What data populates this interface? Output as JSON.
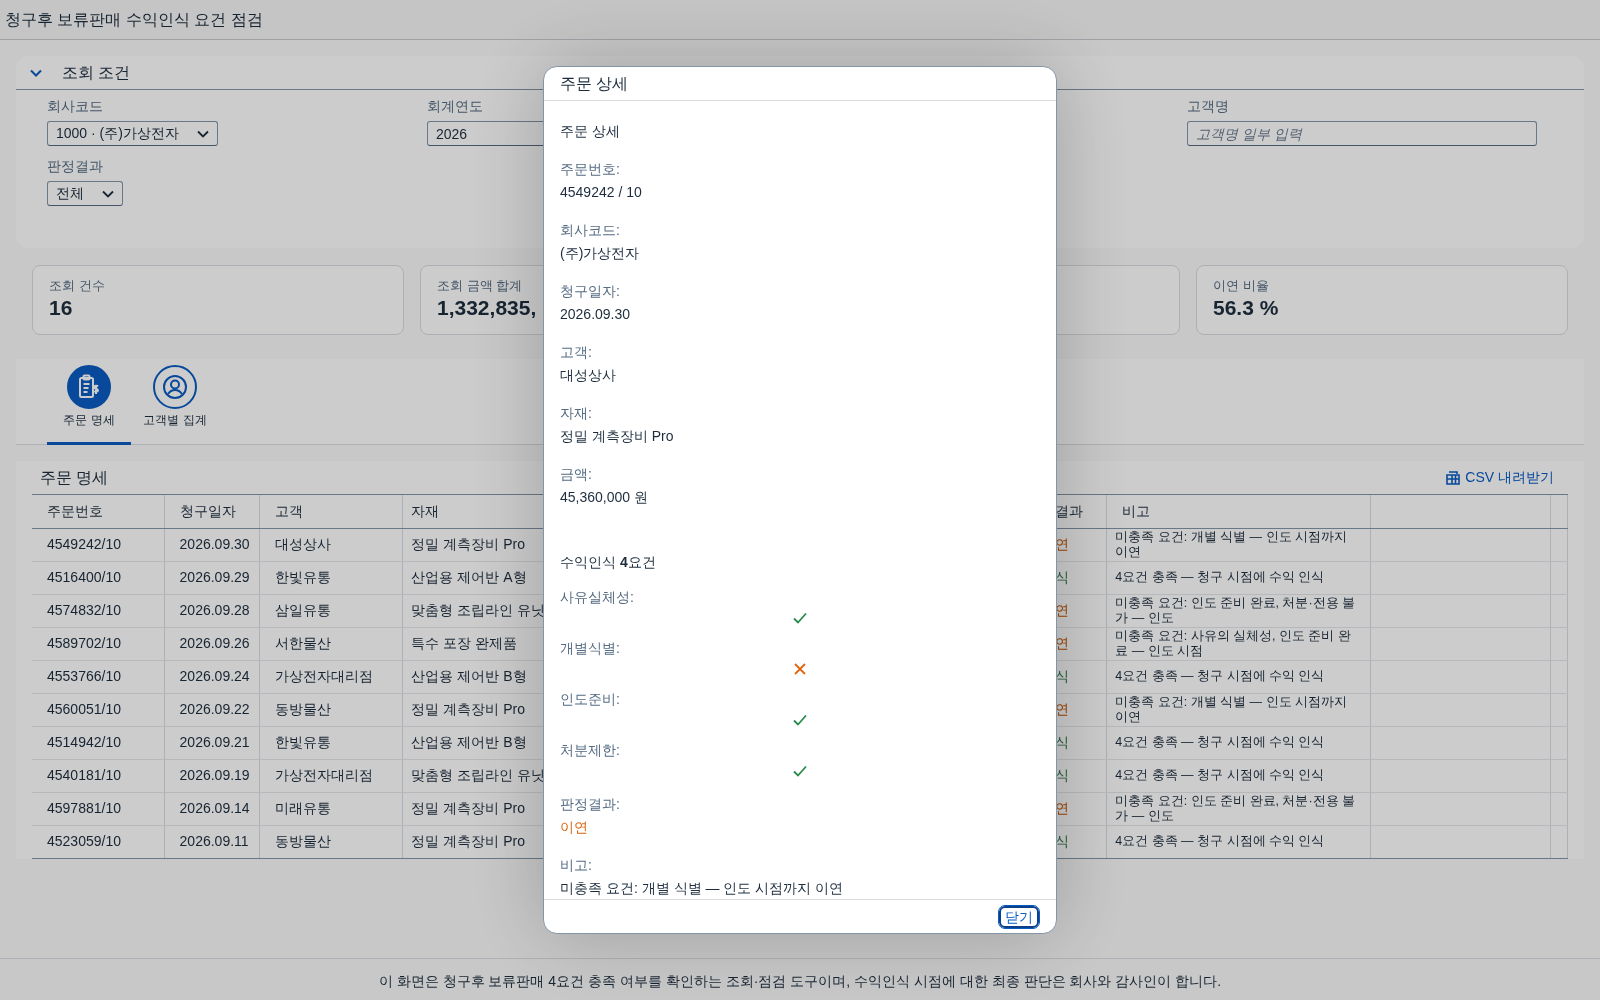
{
  "app_title": "청구후 보류판매 수익인식 요건 점검",
  "filter_panel": {
    "title": "조회 조건",
    "expanded": true,
    "fields": [
      {
        "kind": "select",
        "label": "회사코드",
        "value": "1000 · (주)가상전자"
      },
      {
        "kind": "input",
        "label": "회계연도",
        "value": "2026"
      },
      {
        "kind": "input",
        "label": "고객명",
        "placeholder": "고객명 일부 입력"
      },
      {
        "kind": "select",
        "label": "판정결과",
        "value": "전체"
      }
    ]
  },
  "kpis": [
    {
      "label": "조회 건수",
      "value": "16"
    },
    {
      "label": "조회 금액 합계",
      "value": "1,332,835,"
    },
    {
      "label": "이연 비율",
      "value": "56.3 %"
    }
  ],
  "tabs": [
    {
      "label": "주문 명세",
      "selected": true
    },
    {
      "label": "고객별 집계",
      "selected": false
    }
  ],
  "table": {
    "title": "주문 명세",
    "csv_button": "CSV 내려받기",
    "columns": [
      "주문번호",
      "청구일자",
      "고객",
      "자재",
      "결과",
      "비고"
    ],
    "rows": [
      {
        "cells": [
          "4549242/10",
          "2026.09.30",
          "대성상사",
          "정밀 계측장비 Pro"
        ],
        "result": {
          "text": "연",
          "kind": "deferred"
        },
        "note": "미충족 요건: 개별 식별 — 인도 시점까지 이연"
      },
      {
        "cells": [
          "4516400/10",
          "2026.09.29",
          "한빛유통",
          "산업용 제어반 A형"
        ],
        "result": {
          "text": "식",
          "kind": "recognized"
        },
        "note": "4요건 충족 — 청구 시점에 수익 인식"
      },
      {
        "cells": [
          "4574832/10",
          "2026.09.28",
          "삼일유통",
          "맞춤형 조립라인 유닛"
        ],
        "result": {
          "text": "연",
          "kind": "deferred"
        },
        "note": "미충족 요건: 인도 준비 완료, 처분·전용 불가 — 인도"
      },
      {
        "cells": [
          "4589702/10",
          "2026.09.26",
          "서한물산",
          "특수 포장 완제품"
        ],
        "result": {
          "text": "연",
          "kind": "deferred"
        },
        "note": "미충족 요건: 사유의 실체성, 인도 준비 완료 — 인도 시점"
      },
      {
        "cells": [
          "4553766/10",
          "2026.09.24",
          "가상전자대리점",
          "산업용 제어반 B형"
        ],
        "result": {
          "text": "식",
          "kind": "recognized"
        },
        "note": "4요건 충족 — 청구 시점에 수익 인식"
      },
      {
        "cells": [
          "4560051/10",
          "2026.09.22",
          "동방물산",
          "정밀 계측장비 Pro"
        ],
        "result": {
          "text": "연",
          "kind": "deferred"
        },
        "note": "미충족 요건: 개별 식별 — 인도 시점까지 이연"
      },
      {
        "cells": [
          "4514942/10",
          "2026.09.21",
          "한빛유통",
          "산업용 제어반 B형"
        ],
        "result": {
          "text": "식",
          "kind": "recognized"
        },
        "note": "4요건 충족 — 청구 시점에 수익 인식"
      },
      {
        "cells": [
          "4540181/10",
          "2026.09.19",
          "가상전자대리점",
          "맞춤형 조립라인 유닛"
        ],
        "result": {
          "text": "식",
          "kind": "recognized"
        },
        "note": "4요건 충족 — 청구 시점에 수익 인식"
      },
      {
        "cells": [
          "4597881/10",
          "2026.09.14",
          "미래유통",
          "정밀 계측장비 Pro"
        ],
        "result": {
          "text": "연",
          "kind": "deferred"
        },
        "note": "미충족 요건: 인도 준비 완료, 처분·전용 불가 — 인도"
      },
      {
        "cells": [
          "4523059/10",
          "2026.09.11",
          "동방물산",
          "정밀 계측장비 Pro"
        ],
        "result": {
          "text": "식",
          "kind": "recognized"
        },
        "note": "4요건 충족 — 청구 시점에 수익 인식"
      }
    ]
  },
  "footer_note": "이 화면은 청구후 보류판매 4요건 충족 여부를 확인하는 조회·점검 도구이며, 수익인식 시점에 대한 최종 판단은 회사와 감사인이 합니다.",
  "modal": {
    "title": "주문 상세",
    "heading": "주문 상세",
    "details": [
      {
        "label": "주문번호:",
        "value": "4549242 / 10"
      },
      {
        "label": "회사코드:",
        "value": "(주)가상전자"
      },
      {
        "label": "청구일자:",
        "value": "2026.09.30"
      },
      {
        "label": "고객:",
        "value": "대성상사"
      },
      {
        "label": "자재:",
        "value": "정밀 계측장비 Pro"
      },
      {
        "label": "금액:",
        "value": "45,360,000 원"
      }
    ],
    "requirements_title": "수익인식 **4**요건",
    "requirements": [
      {
        "label": "사유실체성:",
        "met": true
      },
      {
        "label": "개별식별:",
        "met": false
      },
      {
        "label": "인도준비:",
        "met": true
      },
      {
        "label": "처분제한:",
        "met": true
      }
    ],
    "verdict": {
      "label": "판정결과:",
      "value": "이연",
      "kind": "deferred"
    },
    "note": {
      "label": "비고:",
      "value": "미충족 요건: 개별 식별 — 인도 시점까지 이연"
    },
    "close_button": "닫기"
  }
}
